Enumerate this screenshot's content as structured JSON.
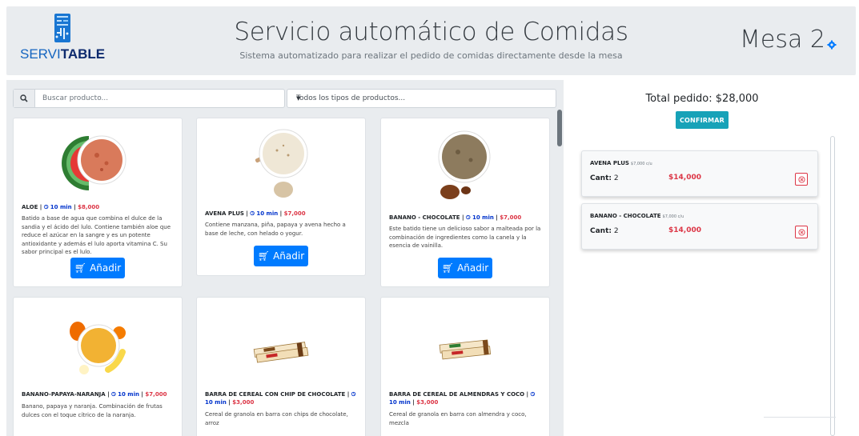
{
  "header": {
    "logo_prefix": "SERVI",
    "logo_suffix": "TABLE",
    "title": "Servicio automático de Comidas",
    "subtitle": "Sistema automatizado para realizar el pedido de comidas directamente desde la mesa",
    "table_label": "Mesa 2",
    "settings_icon": "gear-icon"
  },
  "filters": {
    "search_placeholder": "Buscar producto...",
    "search_icon": "search-icon",
    "type_select_value": "Todos los tipos de productos..."
  },
  "products": [
    {
      "name": "ALOE",
      "time": "10 min",
      "price": "$8,000",
      "description": "Batido a base de agua que combina el dulce de la sandia y el ácido del lulo. Contiene también aloe que reduce el azúcar en la sangre y es un potente antioxidante y además el lulo aporta vitamina C. Su sabor principal es el lulo.",
      "button": "Añadir",
      "image": "watermelon-smoothie-bowl"
    },
    {
      "name": "AVENA PLUS",
      "time": "10 min",
      "price": "$7,000",
      "description": "Contiene manzana, piña, papaya y avena hecho a base de leche, con helado o yogur.",
      "button": "Añadir",
      "image": "oat-smoothie-bowl"
    },
    {
      "name": "BANANO - CHOCOLATE",
      "time": "10 min",
      "price": "$7,000",
      "description": "Este batido tiene un delicioso sabor a malteada por la combinación de ingredientes como la canela y la esencia de vainilla.",
      "button": "Añadir",
      "image": "chocolate-smoothie-bowl"
    },
    {
      "name": "BANANO-PAPAYA-NARANJA",
      "time": "10 min",
      "price": "$7,000",
      "description": "Banano, papaya y naranja. Combinación de frutas dulces con el toque cítrico de la naranja.",
      "image": "fruit-smoothie-bowl"
    },
    {
      "name": "BARRA DE CEREAL CON CHIP DE CHOCOLATE",
      "time": "10 min",
      "price": "$3,000",
      "description": "Cereal de granola en barra con chips de chocolate, arroz",
      "image": "cereal-bar-chocolate"
    },
    {
      "name": "BARRA DE CEREAL DE ALMENDRAS Y COCO",
      "time": "10 min",
      "price": "$3,000",
      "description": "Cereal de granola en barra con almendra y coco, mezcla",
      "image": "cereal-bar-almond"
    }
  ],
  "order": {
    "total_label": "Total pedido: $28,000",
    "confirm_label": "CONFIRMAR",
    "items": [
      {
        "name": "AVENA PLUS",
        "unit_price": "$7,000 c/u",
        "qty_label": "Cant:",
        "qty": "2",
        "subtotal": "$14,000"
      },
      {
        "name": "BANANO - CHOCOLATE",
        "unit_price": "$7,000 c/u",
        "qty_label": "Cant:",
        "qty": "2",
        "subtotal": "$14,000"
      }
    ]
  },
  "colors": {
    "primary": "#007bff",
    "info": "#17a2b8",
    "danger": "#dc3545",
    "time_blue": "#0033cc",
    "panel_bg": "#e9ecef"
  }
}
